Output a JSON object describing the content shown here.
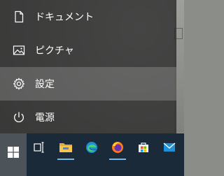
{
  "start_menu": {
    "items": [
      {
        "label": "ドキュメント",
        "icon": "document-icon"
      },
      {
        "label": "ピクチャ",
        "icon": "picture-icon"
      },
      {
        "label": "設定",
        "icon": "gear-icon"
      },
      {
        "label": "電源",
        "icon": "power-icon"
      }
    ]
  },
  "taskbar": {
    "apps": [
      {
        "icon": "start-windows-icon"
      },
      {
        "icon": "task-view-icon"
      },
      {
        "icon": "file-explorer-icon"
      },
      {
        "icon": "edge-icon"
      },
      {
        "icon": "firefox-icon"
      },
      {
        "icon": "store-icon"
      },
      {
        "icon": "mail-icon"
      }
    ]
  },
  "colors": {
    "accent": "#76b9ed",
    "menu_bg": "#282828",
    "taskbar_bg": "#1a2a38"
  }
}
